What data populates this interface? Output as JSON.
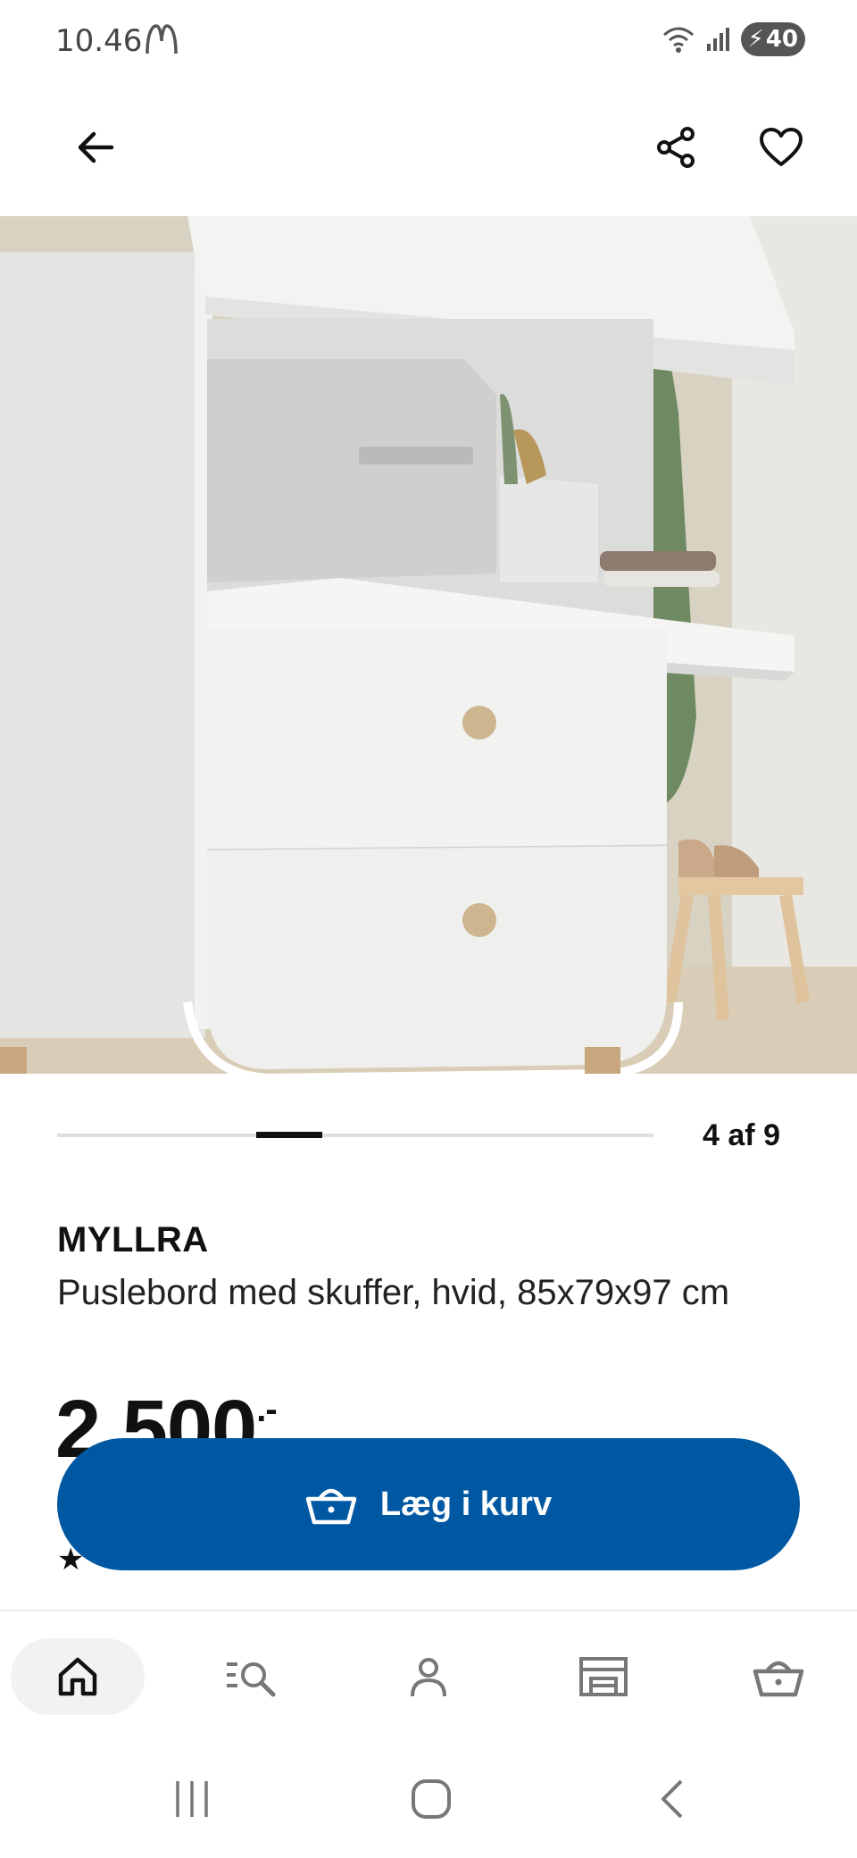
{
  "status_bar": {
    "time": "10.46",
    "battery": "40"
  },
  "top_bar": {
    "back_icon": "arrow-left-icon",
    "share_icon": "share-icon",
    "favorite_icon": "heart-icon"
  },
  "gallery": {
    "counter": "4 af 9",
    "current_index": 4,
    "total": 9
  },
  "product": {
    "brand": "MYLLRA",
    "description": "Puslebord med skuffer, hvid, 85x79x97 cm",
    "price": "2 500",
    "price_suffix": ".-"
  },
  "add_to_cart": {
    "label": "Læg i kurv",
    "icon": "basket-icon",
    "color": "#0058a3"
  },
  "bottom_nav": {
    "items": [
      {
        "name": "home",
        "icon": "home-icon",
        "active": true
      },
      {
        "name": "search",
        "icon": "search-list-icon",
        "active": false
      },
      {
        "name": "profile",
        "icon": "person-icon",
        "active": false
      },
      {
        "name": "stores",
        "icon": "store-icon",
        "active": false
      },
      {
        "name": "cart",
        "icon": "basket-icon",
        "active": false
      }
    ]
  }
}
